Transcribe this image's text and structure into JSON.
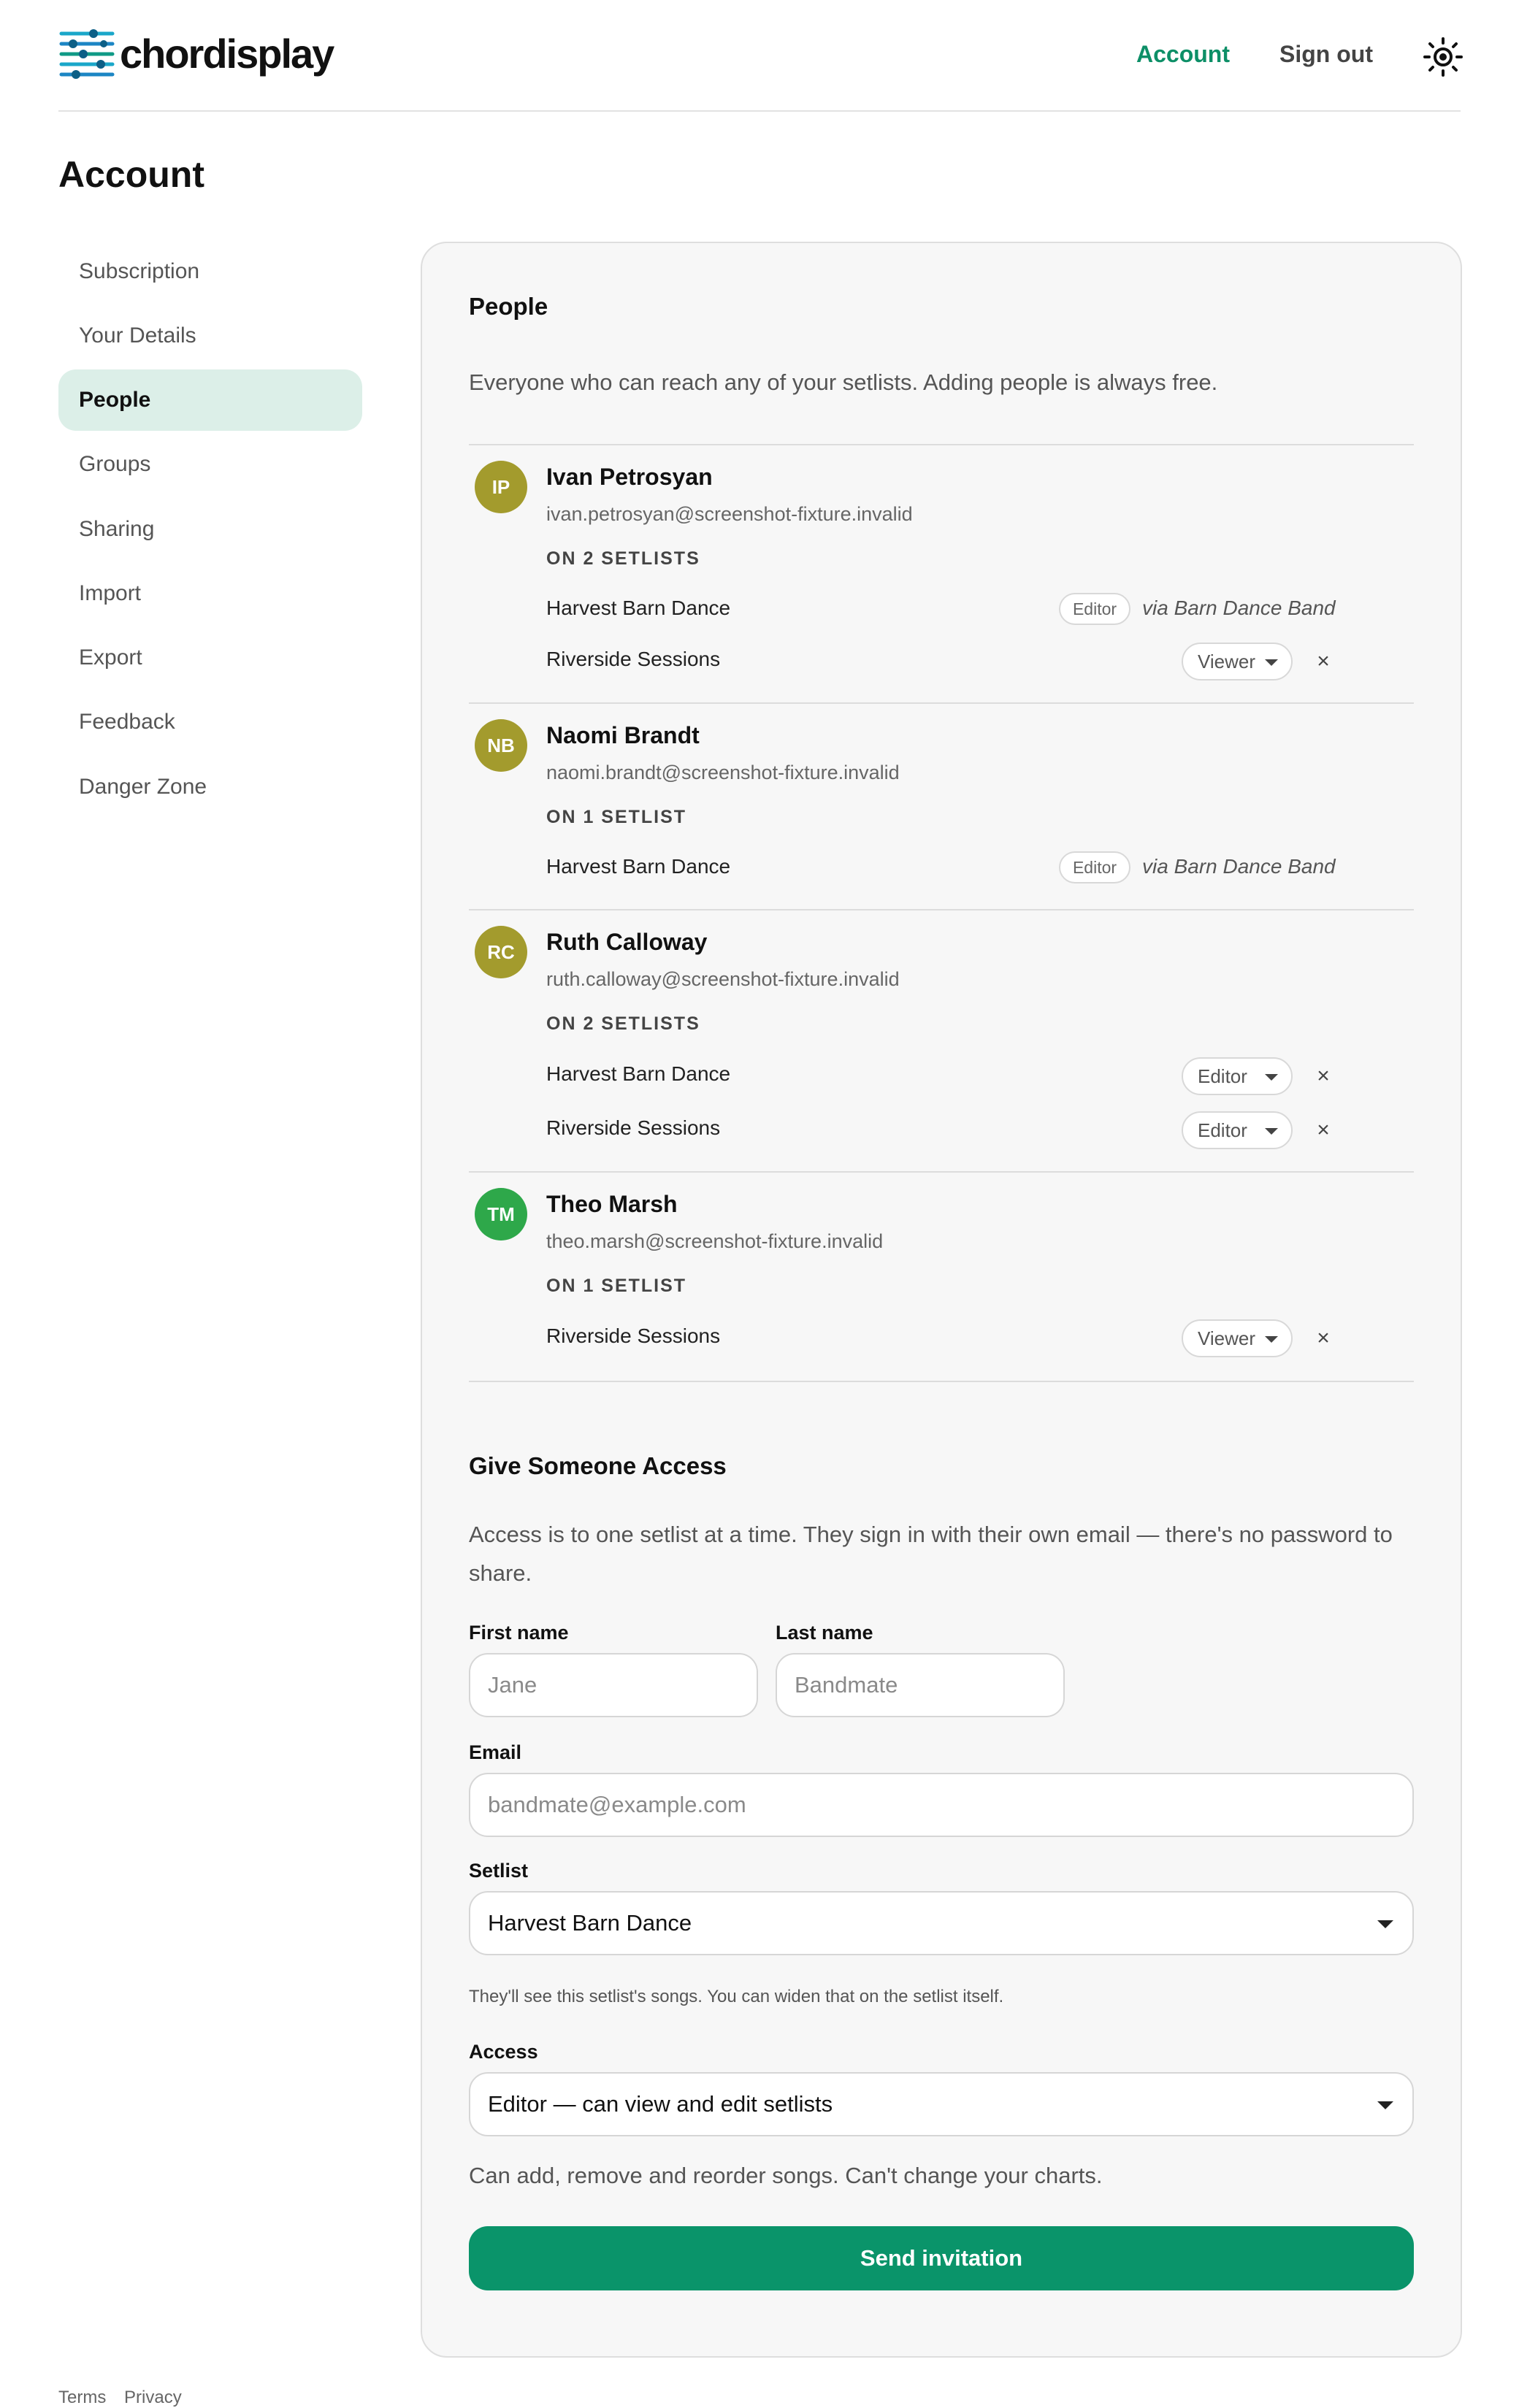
{
  "header": {
    "logo_text": "chordisplay",
    "nav": {
      "account": "Account",
      "sign_out": "Sign out"
    },
    "accent_color": "#0d8f67"
  },
  "page_title": "Account",
  "sidebar": {
    "items": [
      {
        "label": "Subscription"
      },
      {
        "label": "Your Details"
      },
      {
        "label": "People",
        "active": true
      },
      {
        "label": "Groups"
      },
      {
        "label": "Sharing"
      },
      {
        "label": "Import"
      },
      {
        "label": "Export"
      },
      {
        "label": "Feedback"
      },
      {
        "label": "Danger Zone"
      }
    ]
  },
  "people": {
    "title": "People",
    "description": "Everyone who can reach any of your setlists. Adding people is always free.",
    "list": [
      {
        "initials": "IP",
        "avatar_color": "#a39b2d",
        "name": "Ivan Petrosyan",
        "email": "ivan.petrosyan@screenshot-fixture.invalid",
        "count_label": "ON 2 SETLISTS",
        "setlists": [
          {
            "name": "Harvest Barn Dance",
            "role": "Editor",
            "via": "via Barn Dance Band"
          },
          {
            "name": "Riverside Sessions",
            "role": "Viewer"
          }
        ]
      },
      {
        "initials": "NB",
        "avatar_color": "#a39b2d",
        "name": "Naomi Brandt",
        "email": "naomi.brandt@screenshot-fixture.invalid",
        "count_label": "ON 1 SETLIST",
        "setlists": [
          {
            "name": "Harvest Barn Dance",
            "role": "Editor",
            "via": "via Barn Dance Band"
          }
        ]
      },
      {
        "initials": "RC",
        "avatar_color": "#a39b2d",
        "name": "Ruth Calloway",
        "email": "ruth.calloway@screenshot-fixture.invalid",
        "count_label": "ON 2 SETLISTS",
        "setlists": [
          {
            "name": "Harvest Barn Dance",
            "role": "Editor"
          },
          {
            "name": "Riverside Sessions",
            "role": "Editor"
          }
        ]
      },
      {
        "initials": "TM",
        "avatar_color": "#2ea84a",
        "name": "Theo Marsh",
        "email": "theo.marsh@screenshot-fixture.invalid",
        "count_label": "ON 1 SETLIST",
        "setlists": [
          {
            "name": "Riverside Sessions",
            "role": "Viewer"
          }
        ]
      }
    ],
    "remove_glyph": "×"
  },
  "invite": {
    "title": "Give Someone Access",
    "description": "Access is to one setlist at a time. They sign in with their own email — there's no password to share.",
    "first_name": {
      "label": "First name",
      "placeholder": "Jane",
      "value": ""
    },
    "last_name": {
      "label": "Last name",
      "placeholder": "Bandmate",
      "value": ""
    },
    "email": {
      "label": "Email",
      "placeholder": "bandmate@example.com",
      "value": ""
    },
    "setlist": {
      "label": "Setlist",
      "value": "Harvest Barn Dance",
      "hint": "They'll see this setlist's songs. You can widen that on the setlist itself."
    },
    "access": {
      "label": "Access",
      "value": "Editor — can view and edit setlists",
      "hint": "Can add, remove and reorder songs. Can't change your charts."
    },
    "submit_label": "Send invitation",
    "button_color": "#0a946a"
  },
  "footer": {
    "terms": "Terms",
    "privacy": "Privacy"
  }
}
